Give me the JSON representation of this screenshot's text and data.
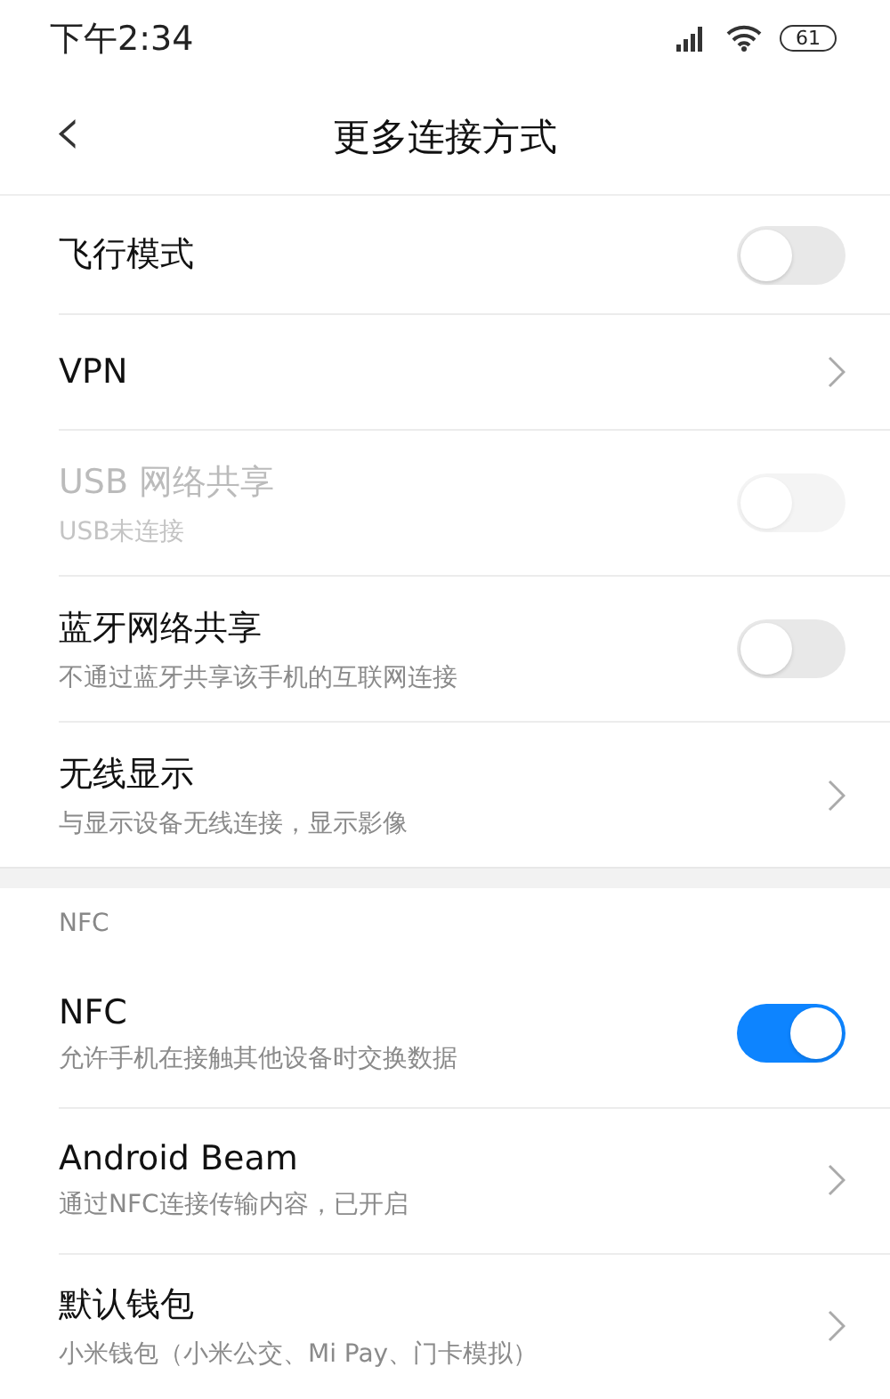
{
  "status_bar": {
    "time": "下午2:34",
    "battery": "61"
  },
  "header": {
    "back": "‹",
    "title": "更多连接方式"
  },
  "sections": [
    {
      "items": [
        {
          "kind": "switch",
          "title": "飞行模式",
          "on": false,
          "disabled": false
        },
        {
          "kind": "link",
          "title": "VPN",
          "disabled": false
        },
        {
          "kind": "switch",
          "title": "USB 网络共享",
          "subtitle": "USB未连接",
          "on": false,
          "disabled": true
        },
        {
          "kind": "switch",
          "title": "蓝牙网络共享",
          "subtitle": "不通过蓝牙共享该手机的互联网连接",
          "on": false,
          "disabled": false
        },
        {
          "kind": "link",
          "title": "无线显示",
          "subtitle": "与显示设备无线连接，显示影像",
          "disabled": false
        }
      ]
    },
    {
      "header": "NFC",
      "items": [
        {
          "kind": "switch",
          "title": "NFC",
          "subtitle": "允许手机在接触其他设备时交换数据",
          "on": true,
          "disabled": false
        },
        {
          "kind": "link",
          "title": "Android Beam",
          "subtitle": "通过NFC连接传输内容，已开启",
          "disabled": false
        },
        {
          "kind": "link",
          "title": "默认钱包",
          "subtitle": "小米钱包（小米公交、Mi Pay、门卡模拟）",
          "disabled": false
        }
      ]
    }
  ]
}
